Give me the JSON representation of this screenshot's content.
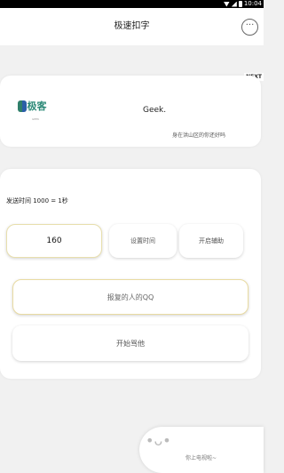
{
  "status_bar": {
    "time": "10:04"
  },
  "header": {
    "title": "极速扣字",
    "more_icon": "more-dots-icon",
    "more_glyph": "···"
  },
  "next_tag": "NEXT",
  "profile_card": {
    "logo_text": "极客",
    "logo_sub": "GEEK",
    "name": "Geek.",
    "subtitle": "身在洪山区的你还好吗"
  },
  "controls": {
    "send_time_label": "发送时间 1000 = 1秒",
    "interval_value": "160",
    "set_time_button": "设置时间",
    "assist_button": "开启辅助",
    "qq_placeholder": "报复的人的QQ",
    "start_button": "开始骂他"
  },
  "bottom_pill": {
    "text": "你上电视啦~",
    "face": "•ᴗ•"
  }
}
